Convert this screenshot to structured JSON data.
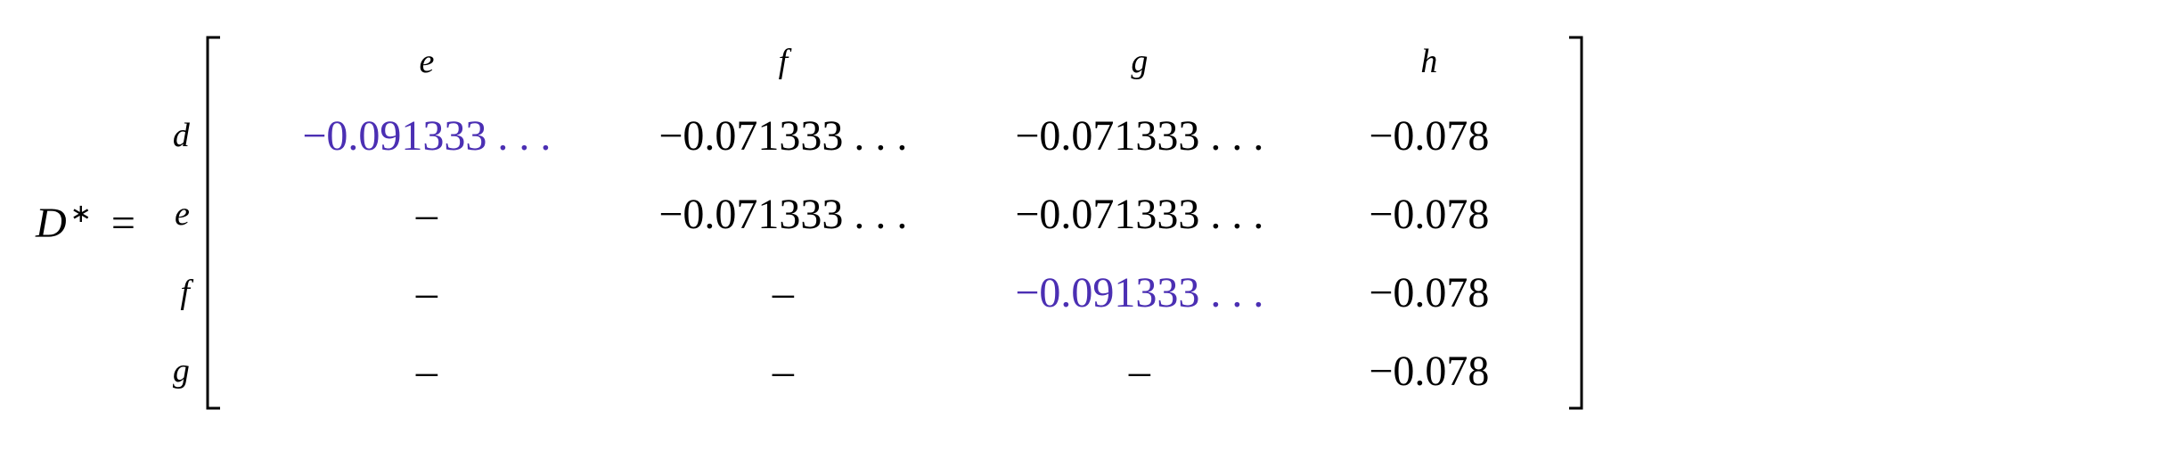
{
  "lhs": "D",
  "superscript": "∗",
  "equals": "=",
  "col_headers": [
    "e",
    "f",
    "g",
    "h"
  ],
  "row_labels": [
    "d",
    "e",
    "f",
    "g"
  ],
  "matrix": [
    [
      {
        "value": "−0.091333 . . .",
        "highlight": true
      },
      {
        "value": "−0.071333 . . .",
        "highlight": false
      },
      {
        "value": "−0.071333 . . .",
        "highlight": false
      },
      {
        "value": "−0.078",
        "highlight": false
      }
    ],
    [
      {
        "value": "–",
        "highlight": false
      },
      {
        "value": "−0.071333 . . .",
        "highlight": false
      },
      {
        "value": "−0.071333 . . .",
        "highlight": false
      },
      {
        "value": "−0.078",
        "highlight": false
      }
    ],
    [
      {
        "value": "–",
        "highlight": false
      },
      {
        "value": "–",
        "highlight": false
      },
      {
        "value": "−0.091333 . . .",
        "highlight": true
      },
      {
        "value": "−0.078",
        "highlight": false
      }
    ],
    [
      {
        "value": "–",
        "highlight": false
      },
      {
        "value": "–",
        "highlight": false
      },
      {
        "value": "–",
        "highlight": false
      },
      {
        "value": "−0.078",
        "highlight": false
      }
    ]
  ]
}
